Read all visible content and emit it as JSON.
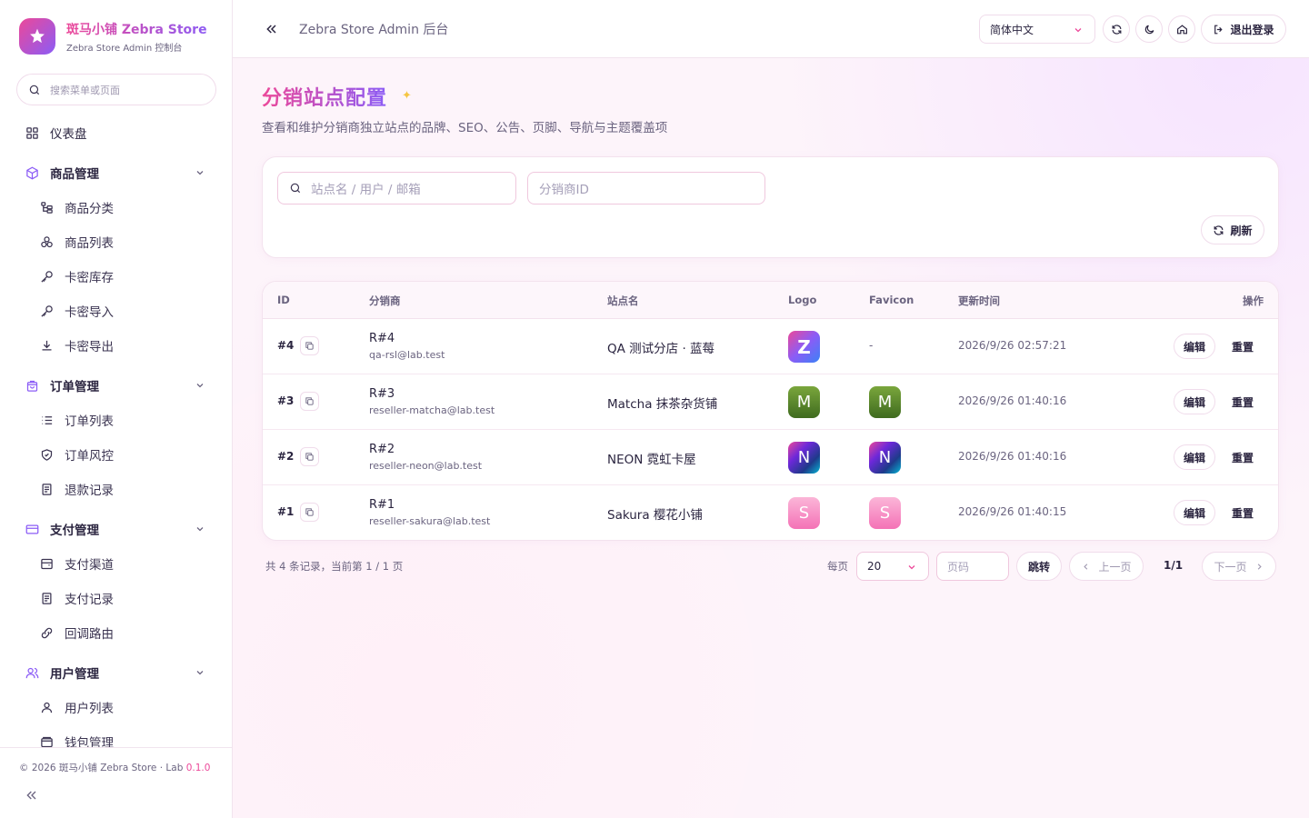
{
  "brand": {
    "title": "斑马小铺 Zebra Store",
    "subtitle": "Zebra Store Admin 控制台"
  },
  "sidebar": {
    "search_placeholder": "搜索菜单或页面",
    "items": [
      {
        "label": "仪表盘",
        "type": "top"
      },
      {
        "label": "商品管理",
        "type": "group"
      },
      {
        "label": "商品分类",
        "type": "sub"
      },
      {
        "label": "商品列表",
        "type": "sub"
      },
      {
        "label": "卡密库存",
        "type": "sub"
      },
      {
        "label": "卡密导入",
        "type": "sub"
      },
      {
        "label": "卡密导出",
        "type": "sub"
      },
      {
        "label": "订单管理",
        "type": "group"
      },
      {
        "label": "订单列表",
        "type": "sub"
      },
      {
        "label": "订单风控",
        "type": "sub"
      },
      {
        "label": "退款记录",
        "type": "sub"
      },
      {
        "label": "支付管理",
        "type": "group"
      },
      {
        "label": "支付渠道",
        "type": "sub"
      },
      {
        "label": "支付记录",
        "type": "sub"
      },
      {
        "label": "回调路由",
        "type": "sub"
      },
      {
        "label": "用户管理",
        "type": "group"
      },
      {
        "label": "用户列表",
        "type": "sub"
      },
      {
        "label": "钱包管理",
        "type": "sub"
      }
    ],
    "footer_text": "© 2026 斑马小铺 Zebra Store · Lab",
    "footer_version": "0.1.0"
  },
  "header": {
    "title": "Zebra Store Admin 后台",
    "language": "简体中文",
    "logout_label": "退出登录"
  },
  "page": {
    "title": "分销站点配置",
    "description": "查看和维护分销商独立站点的品牌、SEO、公告、页脚、导航与主题覆盖项"
  },
  "filters": {
    "search_placeholder": "站点名 / 用户 / 邮箱",
    "reseller_id_placeholder": "分销商ID",
    "refresh_label": "刷新"
  },
  "table": {
    "columns": [
      "ID",
      "分销商",
      "站点名",
      "Logo",
      "Favicon",
      "更新时间",
      "操作"
    ],
    "rows": [
      {
        "id": "#4",
        "reseller": "R#4",
        "email": "qa-rsl@lab.test",
        "site": "QA 测试分店 · 蓝莓",
        "logo": "Z",
        "logo_color": "#8b5cf6",
        "favicon": "",
        "favicon_color": "",
        "updated": "2026/9/26 02:57:21"
      },
      {
        "id": "#3",
        "reseller": "R#3",
        "email": "reseller-matcha@lab.test",
        "site": "Matcha 抹茶杂货铺",
        "logo": "M",
        "logo_color": "#5b8a2a",
        "favicon": "M",
        "favicon_color": "#5b8a2a",
        "updated": "2026/9/26 01:40:16"
      },
      {
        "id": "#2",
        "reseller": "R#2",
        "email": "reseller-neon@lab.test",
        "site": "NEON 霓虹卡屋",
        "logo": "N",
        "logo_color": "#4f46e5",
        "favicon": "N",
        "favicon_color": "#4f46e5",
        "updated": "2026/9/26 01:40:16"
      },
      {
        "id": "#1",
        "reseller": "R#1",
        "email": "reseller-sakura@lab.test",
        "site": "Sakura 樱花小铺",
        "logo": "S",
        "logo_color": "#f472b6",
        "favicon": "S",
        "favicon_color": "#f472b6",
        "updated": "2026/9/26 01:40:15"
      }
    ],
    "empty_favicon": "-",
    "edit_label": "编辑",
    "reset_label": "重置"
  },
  "pagination": {
    "info": "共 4 条记录，当前第 1 / 1 页",
    "per_page_label": "每页",
    "per_page_value": "20",
    "page_placeholder": "页码",
    "jump_label": "跳转",
    "prev_label": "上一页",
    "current": "1/1",
    "next_label": "下一页"
  },
  "colors": {
    "accent_pink": "#ec4899",
    "accent_purple": "#8b5cf6"
  }
}
